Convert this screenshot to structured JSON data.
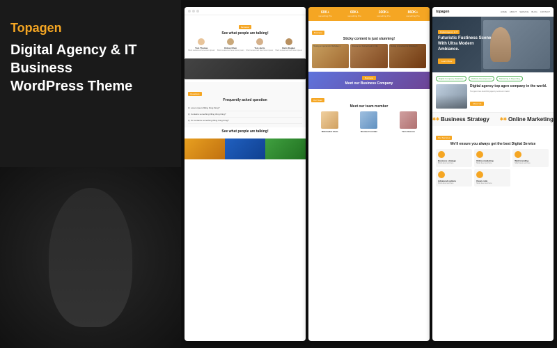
{
  "brand": {
    "name": "Topagen",
    "tagline": "Digital Agency & IT Business",
    "subtitle": "WordPress Theme"
  },
  "hero": {
    "tag": "Digital Agency & IT",
    "title": "Futuristic Fustiness Scene With Ultra Modern Ambiance.",
    "cta_label": "Learn More"
  },
  "stats": [
    {
      "number": "60K+",
      "label": "something Pro"
    },
    {
      "number": "60K+",
      "label": "something Pro"
    },
    {
      "number": "160K+",
      "label": "something Pro"
    },
    {
      "number": "860K+",
      "label": "something Pro"
    }
  ],
  "sections": {
    "testimonials_title": "See what people are talking!",
    "testimonials_label": "Reviewer",
    "sticky_title": "Sticky content is just stunning!",
    "sticky_label": "Business",
    "faq_title": "Frequently asked question",
    "faq_label": "Questions",
    "meet_label": "Business",
    "meet_title": "Meet our Business Company",
    "team_label": "Our Team",
    "team_title": "Meet our team member"
  },
  "people": [
    {
      "name": "Tom Thomas"
    },
    {
      "name": "Rohan Khan"
    },
    {
      "name": "Tom Jarris"
    },
    {
      "name": "Darin Dogker"
    }
  ],
  "team_members": [
    {
      "name": "Mahmudul Islam"
    },
    {
      "name": "Nicolas Fountain"
    },
    {
      "name": "Yaris Hassan"
    }
  ],
  "feature_tags": [
    "Digital Company Database",
    "Website Development",
    "Marketing & Reporting"
  ],
  "feature": {
    "heading": "Digital agency top agen company in the world.",
    "desc": "Text goes here describing agency services in detail.",
    "btn": "About Us"
  },
  "marquee_items": [
    "Business Strategy",
    "Online Marketing"
  ],
  "services": [
    {
      "name": "Business strategy",
      "desc": "Short desc text here"
    },
    {
      "name": "Online marketing",
      "desc": "Short desc text here"
    },
    {
      "name": "Web branding",
      "desc": "Short desc text here"
    },
    {
      "name": "Advanced options",
      "desc": "Short desc text here"
    },
    {
      "name": "Clean code",
      "desc": "Short desc text here"
    }
  ],
  "services_section_label": "Our Services",
  "services_section_title": "We'll ensure you always get the best Digital Service",
  "faq_items": [
    "Q: Lorem ipsum filling thing thing?",
    "Q: Contains something filling thing thing?",
    "Q: On contains something filling thing thing?"
  ],
  "nav": {
    "logo": "topagen",
    "items": [
      "HOME",
      "ABOUT",
      "SERVICE",
      "BLOG",
      "CONTACT"
    ]
  }
}
